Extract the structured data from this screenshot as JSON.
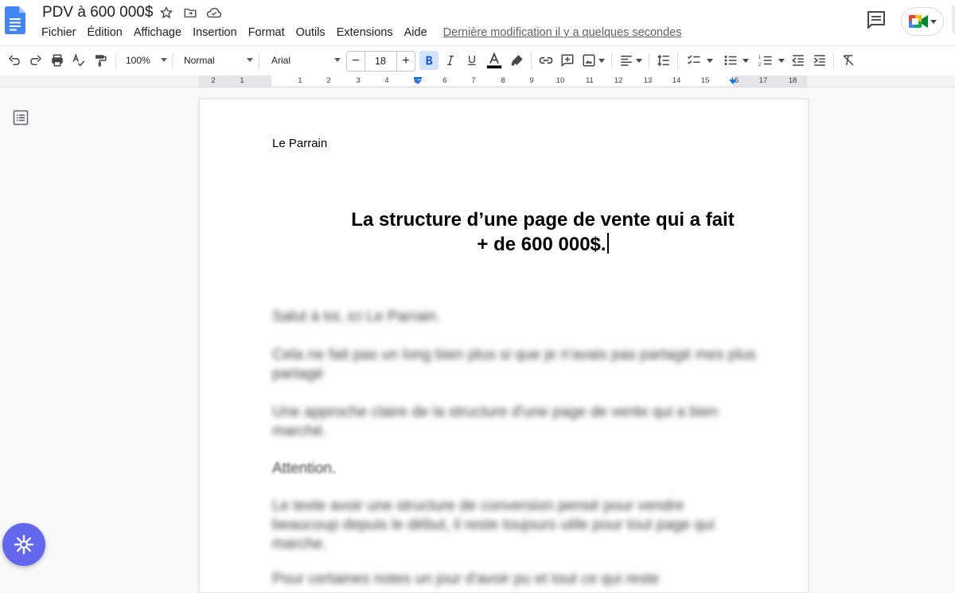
{
  "document": {
    "title": "PDV à 600 000$"
  },
  "menu": {
    "items": [
      "Fichier",
      "Édition",
      "Affichage",
      "Insertion",
      "Format",
      "Outils",
      "Extensions",
      "Aide"
    ],
    "last_edit": "Dernière modification il y a quelques secondes"
  },
  "toolbar": {
    "zoom": "100%",
    "style": "Normal",
    "font": "Arial",
    "font_size": "18",
    "minus": "−",
    "plus": "+"
  },
  "ruler": {
    "left_labels": [
      "2",
      "1"
    ],
    "labels": [
      "1",
      "2",
      "3",
      "4",
      "5",
      "6",
      "7",
      "8",
      "9",
      "10",
      "11",
      "12",
      "13",
      "14",
      "15",
      "16",
      "17",
      "18"
    ]
  },
  "content": {
    "author": "Le Parrain",
    "heading_line1": "La structure d’une page de vente qui a fait",
    "heading_line2": "+ de 600 000$.",
    "blurred_paragraphs": [
      "Salut à toi, ici Le Parrain.",
      "Cela ne fait pas un long bien plus si que je n'avais pas partagé mes plus",
      "partagé",
      "Une approche claire de la structure d'une page de vente qui a bien",
      "marché.",
      "Attention.",
      "Le texte avoir une structure de conversion pensé pour vendre",
      "beaucoup depuis le début, il reste toujours utile pour tout page qui",
      "marche.",
      "Pour certaines notes un jour d'avoir pu et tout ce qui reste"
    ]
  },
  "colors": {
    "brand_blue": "#4285f4",
    "bold_active_bg": "#d3e3fd",
    "fab": "#6367ee"
  }
}
